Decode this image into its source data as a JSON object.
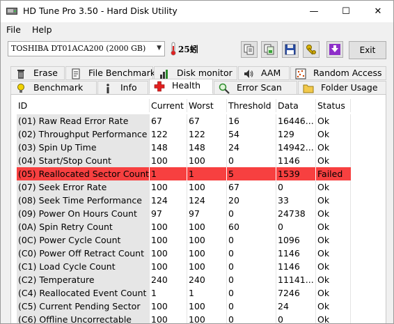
{
  "window": {
    "title": "HD Tune Pro 3.50 - Hard Disk Utility",
    "min": "—",
    "max": "☐",
    "close": "✕"
  },
  "menu": {
    "file": "File",
    "help": "Help"
  },
  "toolbar": {
    "drive": "TOSHIBA DT01ACA200 (2000 GB)",
    "temperature": "25蚓",
    "exit_label": "Exit"
  },
  "tabs_row1": [
    {
      "label": "Erase",
      "icon": "trash-icon"
    },
    {
      "label": "File Benchmark",
      "icon": "file-benchmark-icon"
    },
    {
      "label": "Disk monitor",
      "icon": "disk-monitor-icon"
    },
    {
      "label": "AAM",
      "icon": "speaker-icon"
    },
    {
      "label": "Random Access",
      "icon": "random-access-icon"
    }
  ],
  "tabs_row2": [
    {
      "label": "Benchmark",
      "icon": "bulb-icon"
    },
    {
      "label": "Info",
      "icon": "info-icon"
    },
    {
      "label": "Health",
      "icon": "health-cross-icon",
      "active": true
    },
    {
      "label": "Error Scan",
      "icon": "magnifier-icon"
    },
    {
      "label": "Folder Usage",
      "icon": "folder-icon"
    }
  ],
  "table": {
    "headers": [
      "ID",
      "Current",
      "Worst",
      "Threshold",
      "Data",
      "Status"
    ],
    "rows": [
      [
        "(01) Raw Read Error Rate",
        "67",
        "67",
        "16",
        "16446...",
        "Ok"
      ],
      [
        "(02) Throughput Performance",
        "122",
        "122",
        "54",
        "129",
        "Ok"
      ],
      [
        "(03) Spin Up Time",
        "148",
        "148",
        "24",
        "14942...",
        "Ok"
      ],
      [
        "(04) Start/Stop Count",
        "100",
        "100",
        "0",
        "1146",
        "Ok"
      ],
      [
        "(05) Reallocated Sector Count",
        "1",
        "1",
        "5",
        "1539",
        "Failed"
      ],
      [
        "(07) Seek Error Rate",
        "100",
        "100",
        "67",
        "0",
        "Ok"
      ],
      [
        "(08) Seek Time Performance",
        "124",
        "124",
        "20",
        "33",
        "Ok"
      ],
      [
        "(09) Power On Hours Count",
        "97",
        "97",
        "0",
        "24738",
        "Ok"
      ],
      [
        "(0A) Spin Retry Count",
        "100",
        "100",
        "60",
        "0",
        "Ok"
      ],
      [
        "(0C) Power Cycle Count",
        "100",
        "100",
        "0",
        "1096",
        "Ok"
      ],
      [
        "(C0) Power Off Retract Count",
        "100",
        "100",
        "0",
        "1146",
        "Ok"
      ],
      [
        "(C1) Load Cycle Count",
        "100",
        "100",
        "0",
        "1146",
        "Ok"
      ],
      [
        "(C2) Temperature",
        "240",
        "240",
        "0",
        "11141...",
        "Ok"
      ],
      [
        "(C4) Reallocated Event Count",
        "1",
        "1",
        "0",
        "7246",
        "Ok"
      ],
      [
        "(C5) Current Pending Sector",
        "100",
        "100",
        "0",
        "24",
        "Ok"
      ],
      [
        "(C6) Offline Uncorrectable",
        "100",
        "100",
        "0",
        "0",
        "Ok"
      ]
    ]
  },
  "colors": {
    "failed_row": "#f74040",
    "id_column_bg": "#e6e6e6"
  }
}
